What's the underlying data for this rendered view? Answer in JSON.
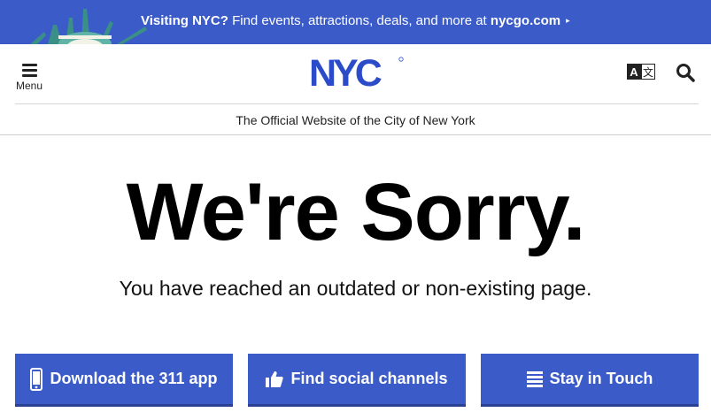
{
  "promo": {
    "bold_lead": "Visiting NYC?",
    "text": " Find events, attractions, deals, and more at ",
    "link": "nycgo.com",
    "caret": "▸"
  },
  "header": {
    "menu_label": "Menu",
    "logo_text": "NYC",
    "translate_icon": "translate-icon",
    "search_icon": "search-icon"
  },
  "tagline": "The Official Website of the City of New York",
  "main": {
    "headline": "We're Sorry.",
    "subtext": "You have reached an outdated or non-existing page."
  },
  "buttons": [
    {
      "label": "Download the 311 app",
      "icon": "phone-icon"
    },
    {
      "label": "Find social channels",
      "icon": "thumbs-up-icon"
    },
    {
      "label": "Stay in Touch",
      "icon": "list-icon"
    }
  ],
  "colors": {
    "brand_blue": "#3b5bc9",
    "logo_blue": "#2b4bc8"
  }
}
